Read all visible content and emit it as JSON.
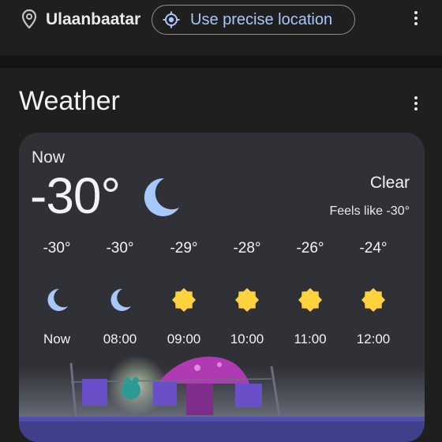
{
  "location": {
    "city": "Ulaanbaatar",
    "precise_label": "Use precise location"
  },
  "weather": {
    "title": "Weather",
    "now_label": "Now",
    "temperature": "-30°",
    "condition": "Clear",
    "feels_like": "Feels like -30°",
    "hourly": [
      {
        "temp": "-30°",
        "time": "Now",
        "icon": "moon-icon"
      },
      {
        "temp": "-30°",
        "time": "08:00",
        "icon": "moon-icon"
      },
      {
        "temp": "-29°",
        "time": "09:00",
        "icon": "sun-icon"
      },
      {
        "temp": "-28°",
        "time": "10:00",
        "icon": "sun-icon"
      },
      {
        "temp": "-26°",
        "time": "11:00",
        "icon": "sun-icon"
      },
      {
        "temp": "-24°",
        "time": "12:00",
        "icon": "sun-icon"
      }
    ]
  },
  "colors": {
    "accent": "#a8c7fa",
    "card": "#2f3136",
    "background": "#1f1f1f",
    "moon": "#a8c7fa",
    "sun": "#fdd23e"
  }
}
